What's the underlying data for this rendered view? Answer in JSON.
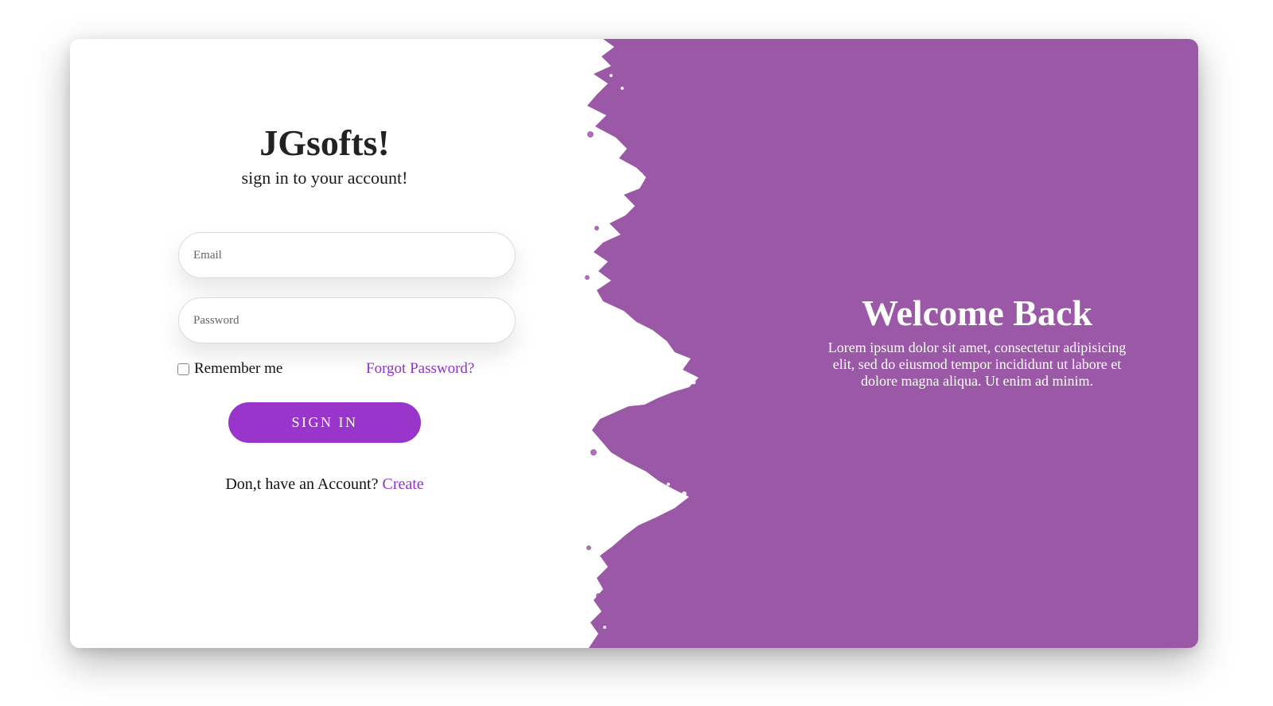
{
  "brand": {
    "title": "JGsofts!",
    "subtitle": "sign in to your account!"
  },
  "form": {
    "email_placeholder": "Email",
    "password_placeholder": "Password",
    "remember_label": "Remember me",
    "forgot_label": "Forgot Password?",
    "signin_label": "SIGN IN",
    "no_account_text": "Don,t have an Account?",
    "create_label": "Create"
  },
  "welcome": {
    "heading": "Welcome Back",
    "text": "Lorem ipsum dolor sit amet, consectetur adipisicing elit, sed do eiusmod tempor incididunt ut labore et dolore magna aliqua. Ut enim ad minim."
  },
  "colors": {
    "accent": "#9a35cc",
    "link": "#8f33c9",
    "panel": "#9a58a6"
  },
  "icons": {
    "checkbox": "checkbox-icon",
    "brush": "paint-brush-edge"
  }
}
